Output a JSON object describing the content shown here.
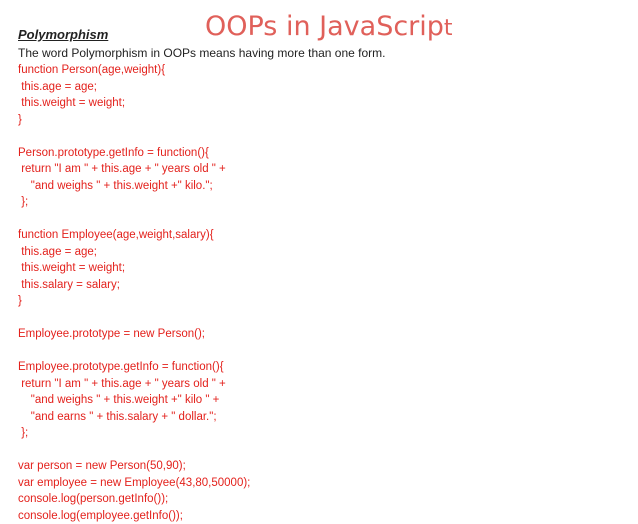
{
  "colors": {
    "title": "#e0605a",
    "text": "#222222",
    "code": "#e3211c",
    "background": "#ffffff"
  },
  "slide": {
    "title_main": "OOPs in JavaScrip",
    "title_last": "t",
    "heading": "Polymorphism",
    "intro": "The word Polymorphism in OOPs means having more than one form.",
    "code_lines": [
      "function Person(age,weight){",
      " this.age = age;",
      " this.weight = weight;",
      "}",
      "",
      "Person.prototype.getInfo = function(){",
      " return \"I am \" + this.age + \" years old \" +",
      "    \"and weighs \" + this.weight +\" kilo.\";",
      " };",
      "",
      "function Employee(age,weight,salary){",
      " this.age = age;",
      " this.weight = weight;",
      " this.salary = salary;",
      "}",
      "",
      "Employee.prototype = new Person();",
      "",
      "Employee.prototype.getInfo = function(){",
      " return \"I am \" + this.age + \" years old \" +",
      "    \"and weighs \" + this.weight +\" kilo \" +",
      "    \"and earns \" + this.salary + \" dollar.\";",
      " };",
      "",
      "var person = new Person(50,90);",
      "var employee = new Employee(43,80,50000);",
      "console.log(person.getInfo());",
      "console.log(employee.getInfo());"
    ]
  }
}
